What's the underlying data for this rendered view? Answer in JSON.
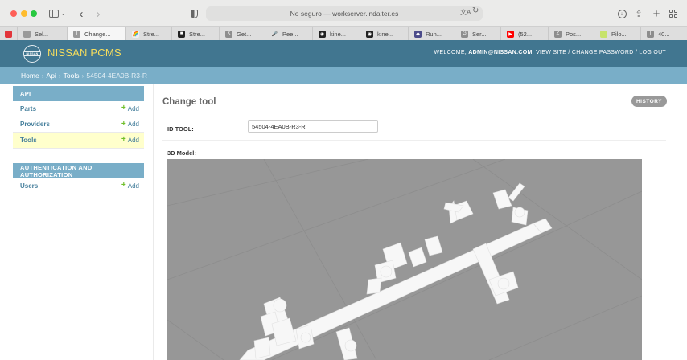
{
  "browser": {
    "address": "No seguro — workserver.indalter.es",
    "tabs": [
      {
        "label": "",
        "favicon_color": "#e2353b",
        "pinned": true
      },
      {
        "label": "Sel...",
        "favicon_color": "#9a9a9a",
        "favicon_char": "I"
      },
      {
        "label": "Change...",
        "favicon_color": "#9a9a9a",
        "favicon_char": "I",
        "active": true
      },
      {
        "label": "Stre...",
        "favicon_color": "#f0f0f0",
        "favicon_char": "🌈"
      },
      {
        "label": "Stre...",
        "favicon_color": "#222222",
        "favicon_char": "■"
      },
      {
        "label": "Get...",
        "favicon_color": "#8d8d8d",
        "favicon_char": "K"
      },
      {
        "label": "Pee...",
        "favicon_color": "#dedede",
        "favicon_char": "🎤"
      },
      {
        "label": "kine...",
        "favicon_color": "#222222",
        "favicon_char": "◉"
      },
      {
        "label": "kine...",
        "favicon_color": "#222222",
        "favicon_char": "◉"
      },
      {
        "label": "Run...",
        "favicon_color": "#4b4b8a",
        "favicon_char": "◆"
      },
      {
        "label": "Ser...",
        "favicon_color": "#8d8d8d",
        "favicon_char": "G"
      },
      {
        "label": "(52...",
        "favicon_color": "#ff0000",
        "favicon_char": "▶"
      },
      {
        "label": "Pos...",
        "favicon_color": "#8d8d8d",
        "favicon_char": "Z"
      },
      {
        "label": "Pilo...",
        "favicon_color": "#c7e36b",
        "favicon_char": " "
      },
      {
        "label": "40...",
        "favicon_color": "#8d8d8d",
        "favicon_char": "I"
      }
    ]
  },
  "header": {
    "site_name": "NISSAN PCMS",
    "logo_text": "NISSAN",
    "welcome": "WELCOME,",
    "username": "ADMIN@NISSAN.COM",
    "view_site": "VIEW SITE",
    "change_password": "CHANGE PASSWORD",
    "log_out": "LOG OUT",
    "separator": "/"
  },
  "breadcrumbs": {
    "home": "Home",
    "app": "Api",
    "model": "Tools",
    "current": "54504-4EA0B-R3-R",
    "separator": "›"
  },
  "sidebar": {
    "toggle_label": "«",
    "modules": [
      {
        "caption": "API",
        "rows": [
          {
            "label": "Parts",
            "add": "Add"
          },
          {
            "label": "Providers",
            "add": "Add"
          },
          {
            "label": "Tools",
            "add": "Add",
            "current": true
          }
        ]
      },
      {
        "caption": "AUTHENTICATION AND AUTHORIZATION",
        "rows": [
          {
            "label": "Users",
            "add": "Add"
          }
        ]
      }
    ]
  },
  "content": {
    "title": "Change tool",
    "history_button": "HISTORY",
    "id_label": "ID TOOL:",
    "id_value": "54504-4EA0B-R3-R",
    "model_label": "3D Model:"
  },
  "colors": {
    "header_bg": "#417690",
    "site_name": "#f5dd5d",
    "breadcrumb_bg": "#79aec8",
    "link": "#447e9b",
    "add_plus": "#70bf2b",
    "current_row_bg": "#ffffcc",
    "viewer_bg": "#979797"
  }
}
